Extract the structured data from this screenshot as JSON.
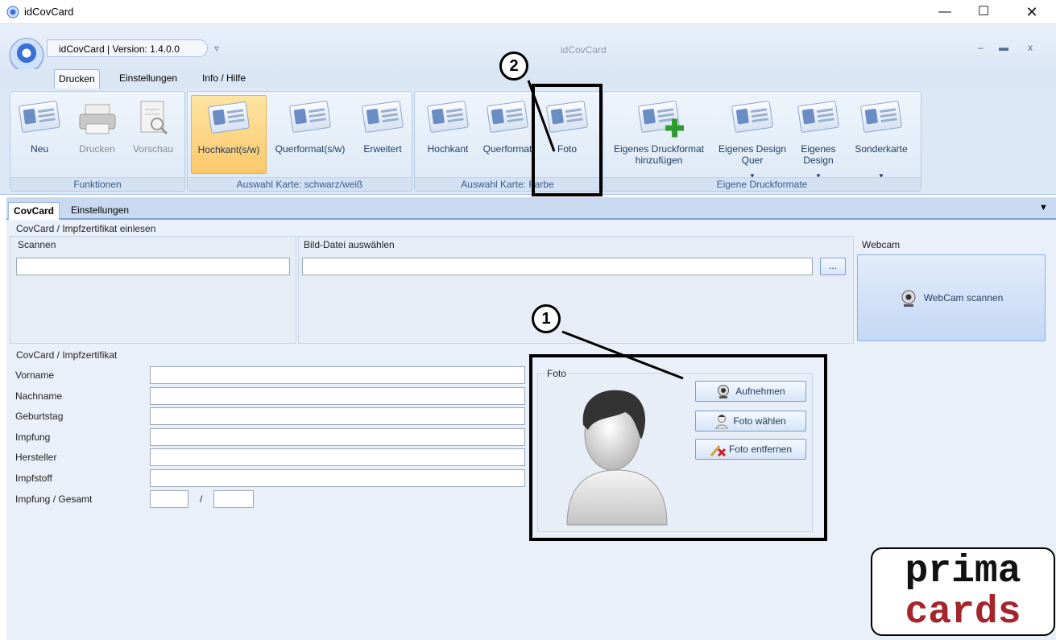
{
  "window": {
    "title": "idCovCard"
  },
  "qat": {
    "version_label": "idCovCard | Version: 1.4.0.0",
    "center_title": "idCovCard"
  },
  "ribbon_tabs": [
    "Drucken",
    "Einstellungen",
    "Info / Hilfe"
  ],
  "groups": {
    "funktionen": {
      "label": "Funktionen",
      "buttons": [
        "Neu",
        "Drucken",
        "Vorschau"
      ]
    },
    "sw": {
      "label": "Auswahl Karte: schwarz/weiß",
      "buttons": [
        "Hochkant(s/w)",
        "Querformat(s/w)",
        "Erweitert"
      ]
    },
    "farbe": {
      "label": "Auswahl Karte: Farbe",
      "label_visible": "Auswahl Karte: ",
      "label_tail": "rbe",
      "buttons": [
        "Hochkant",
        "Querformat",
        "Foto"
      ]
    },
    "eigene": {
      "label": "Eigene Druckformate",
      "buttons": [
        "Eigenes Druckformat hinzufügen",
        "Eigenes Design Quer",
        "Eigenes Design",
        "Sonderkarte"
      ]
    }
  },
  "subtabs": [
    "CovCard",
    "Einstellungen"
  ],
  "einlesen": {
    "title": "CovCard / Impfzertifikat einlesen",
    "scannen_label": "Scannen",
    "bild_label": "Bild-Datei auswählen",
    "browse_label": "...",
    "webcam_label": "Webcam",
    "webcam_button": "WebCam scannen"
  },
  "form": {
    "title": "CovCard / Impfzertifikat",
    "fields": [
      "Vorname",
      "Nachname",
      "Geburtstag",
      "Impfung",
      "Hersteller",
      "Impfstoff",
      "Impfung / Gesamt"
    ],
    "slash": "/"
  },
  "foto": {
    "title": "Foto",
    "buttons": [
      "Aufnehmen",
      "Foto wählen",
      "Foto entfernen"
    ]
  },
  "annotations": [
    "1",
    "2"
  ],
  "logo": {
    "line1": "prima",
    "line2": "cards"
  },
  "colors": {
    "accent": "#3a6fd8",
    "selected": "#fbc86a",
    "logo_red": "#a4262c"
  }
}
